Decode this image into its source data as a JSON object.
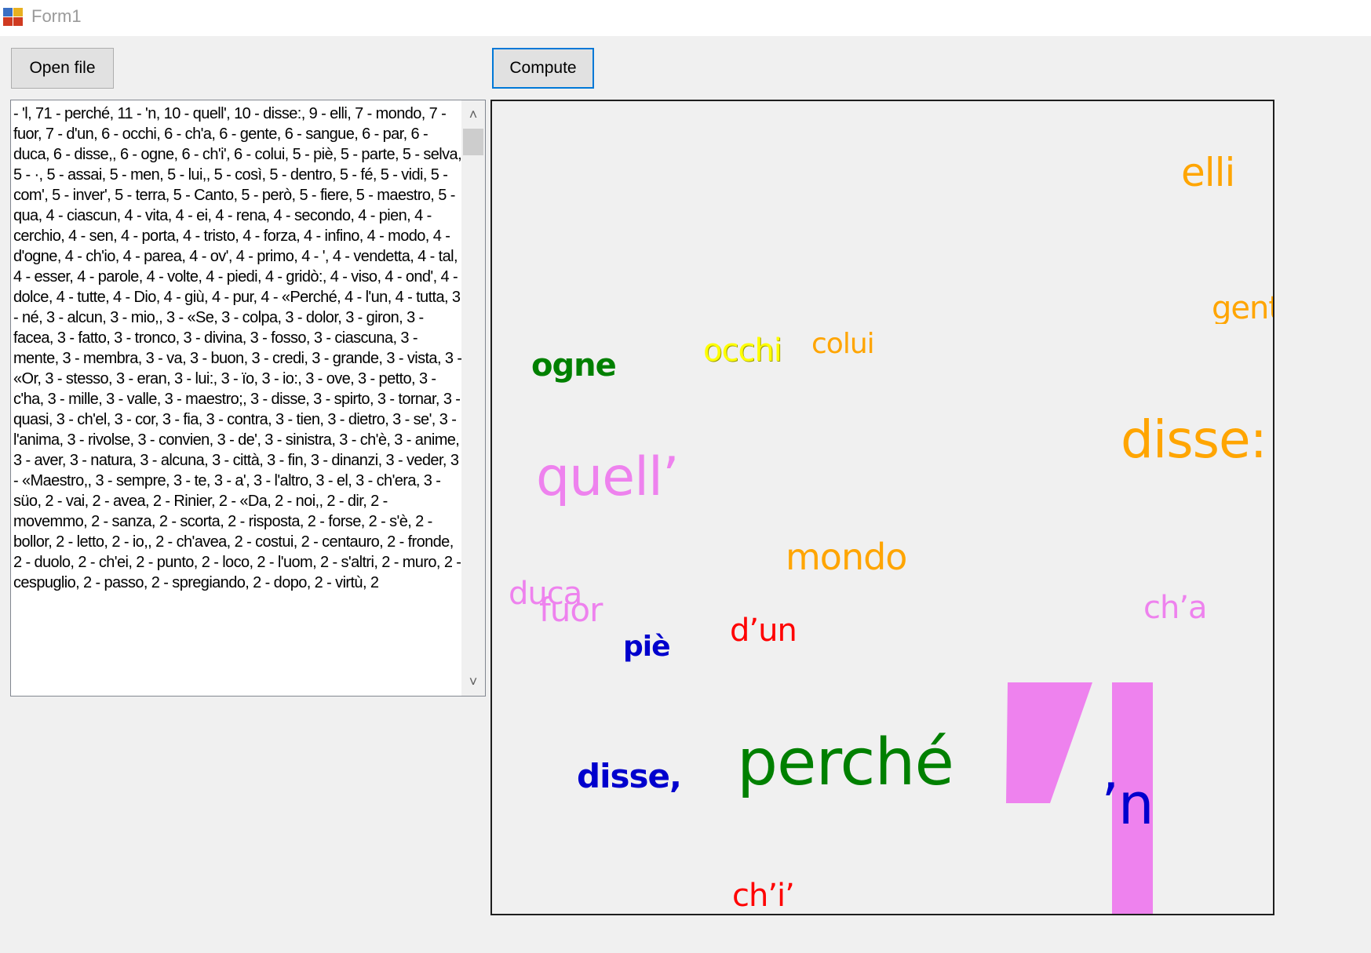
{
  "window": {
    "title": "Form1"
  },
  "toolbar": {
    "open_label": "Open file",
    "compute_label": "Compute"
  },
  "textbox": {
    "content": " - 'l, 71  - perché, 11  - 'n, 10  - quell', 10  - disse:, 9  - elli, 7  - mondo, 7  - fuor, 7  - d'un, 6  - occhi, 6  - ch'a, 6  - gente, 6  - sangue, 6  - par, 6  - duca, 6  - disse,, 6  - ogne, 6  - ch'i', 6  - colui, 5  - piè, 5  - parte, 5  - selva, 5  - ·, 5  - assai, 5  - men, 5  - lui,, 5  - così, 5  - dentro, 5  - fé, 5  - vidi, 5  - com', 5  - inver', 5  - terra, 5  - Canto, 5  - però, 5  - fiere, 5  - maestro, 5  - qua, 4  - ciascun, 4  - vita, 4  - ei, 4  - rena, 4  - secondo, 4  - pien, 4  - cerchio, 4  - sen, 4  - porta, 4  - tristo, 4  - forza, 4  - infino, 4  - modo, 4  - d'ogne, 4  - ch'io, 4  - parea, 4  - ov', 4  - primo, 4  - ', 4  - vendetta, 4  - tal, 4  - esser, 4  - parole, 4  - volte, 4  - piedi, 4  - gridò:, 4  - viso, 4  - ond', 4  - dolce, 4  - tutte, 4  - Dio, 4  - giù, 4  - pur, 4  - «Perché, 4  - l'un, 4  - tutta, 3  - né, 3  - alcun, 3  - mio,, 3  - «Se, 3  - colpa, 3  - dolor, 3  - giron, 3  - facea, 3  - fatto, 3  - tronco, 3  - divina, 3  - fosso, 3  - ciascuna, 3  - mente, 3  - membra, 3  - va, 3  - buon, 3  - credi, 3  - grande, 3  - vista, 3  - «Or, 3  - stesso, 3  - eran, 3  - lui:, 3  - ïo, 3  - io:, 3  - ove, 3  - petto, 3  - c'ha, 3  - mille, 3  - valle, 3  - maestro;, 3  - disse, 3  - spirto, 3  - tornar, 3  - quasi, 3  - ch'el, 3  - cor, 3  - fia, 3  - contra, 3  - tien, 3  - dietro, 3  - se', 3  - l'anima, 3  - rivolse, 3  - convien, 3  - de', 3  - sinistra, 3  - ch'è, 3  - anime, 3  - aver, 3  - natura, 3  - alcuna, 3  - città, 3  - fin, 3  - dinanzi, 3  - veder, 3  - «Maestro,, 3  - sempre, 3  - te, 3  - a', 3  - l'altro, 3  - el, 3  - ch'era, 3  - süo, 2  - vai, 2  - avea, 2  - Rinier, 2  - «Da, 2  - noi,, 2  - dir, 2  - movemmo, 2  - sanza, 2  - scorta, 2  - risposta, 2  - forse, 2  - s'è, 2  - bollor, 2  - letto, 2  - io,, 2  - ch'avea, 2  - costui, 2  - centauro, 2  - fronde, 2  - duolo, 2  - ch'ei, 2  - punto, 2  - loco, 2  - l'uom, 2  - s'altri, 2  - muro, 2  - cespuglio, 2  - passo, 2  - spregiando, 2  - dopo, 2  - virtù, 2"
  },
  "scrollbar": {
    "up_icon": "chevron-up-icon",
    "down_icon": "chevron-down-icon"
  },
  "wordcloud": {
    "colors": {
      "pink": "#ee82ee",
      "green": "#008000",
      "orange": "#ffa500",
      "yellow": "#ffff00",
      "red": "#ff0000",
      "blue": "#0000cd"
    },
    "words": [
      {
        "text": "elli",
        "color": "orange"
      },
      {
        "text": "gente",
        "color": "orange"
      },
      {
        "text": "ogne",
        "color": "green"
      },
      {
        "text": "occhi",
        "color": "yellow"
      },
      {
        "text": "colui",
        "color": "orange"
      },
      {
        "text": "disse:",
        "color": "orange"
      },
      {
        "text": "quell’",
        "color": "pink"
      },
      {
        "text": "mondo",
        "color": "orange"
      },
      {
        "text": "duca",
        "color": "pink"
      },
      {
        "text": "fuor",
        "color": "pink"
      },
      {
        "text": "ch’a",
        "color": "pink"
      },
      {
        "text": "d’un",
        "color": "red"
      },
      {
        "text": "piè",
        "color": "blue"
      },
      {
        "text": "disse,",
        "color": "blue"
      },
      {
        "text": "perché",
        "color": "green"
      },
      {
        "text": "’l",
        "color": "pink"
      },
      {
        "text": "’n",
        "color": "blue"
      },
      {
        "text": "ch’i’",
        "color": "red"
      }
    ]
  }
}
